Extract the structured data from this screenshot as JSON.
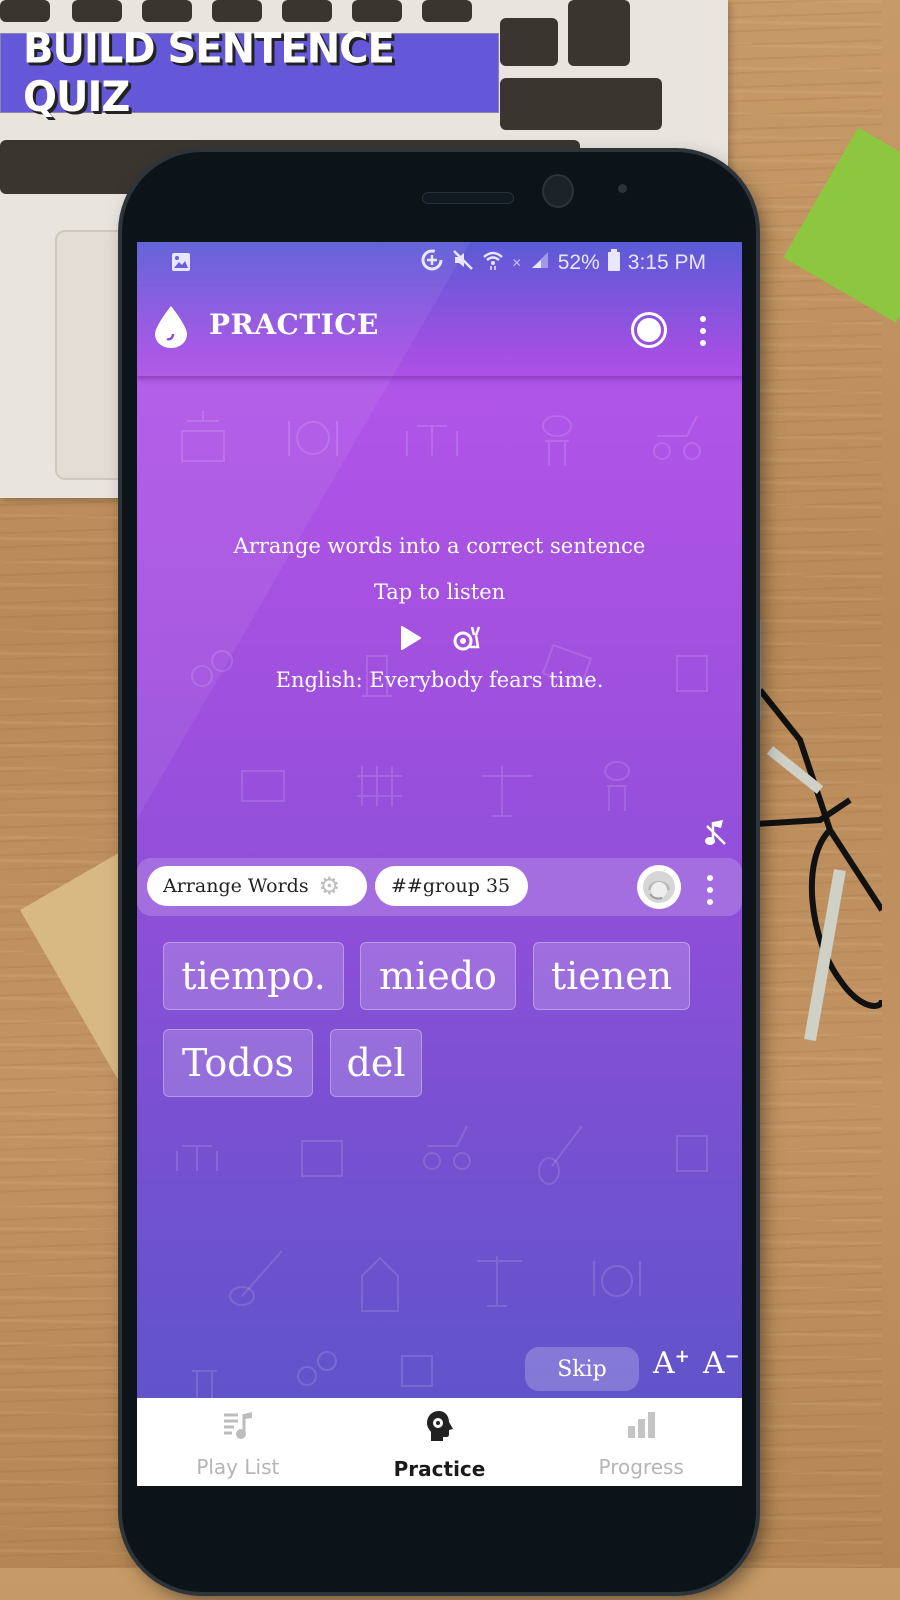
{
  "banner": {
    "title": "BUILD SENTENCE QUIZ"
  },
  "status_bar": {
    "battery": "52%",
    "time": "3:15 PM",
    "icons": [
      "gallery-icon",
      "data-saver-icon",
      "mute-icon",
      "wifi-icon",
      "nfc-icon",
      "signal-icon",
      "battery-icon"
    ]
  },
  "app_bar": {
    "title": "PRACTICE",
    "icons": [
      "drop-logo-icon",
      "timer-icon",
      "more-options-icon"
    ]
  },
  "prompt": {
    "instruction": "Arrange words into a correct sentence",
    "tap_to_listen": "Tap to listen",
    "translation": "English: Everybody fears time.",
    "controls": [
      "play-icon",
      "slow-play-snail-icon"
    ]
  },
  "tag_bar": {
    "mode_chip": "Arrange Words",
    "group_chip": "##group 35",
    "icons": [
      "mute-sound-icon",
      "settings-gear-icon",
      "support-agent-avatar-icon",
      "more-options-icon"
    ]
  },
  "word_tiles": [
    {
      "text": "tiempo."
    },
    {
      "text": "miedo"
    },
    {
      "text": "tienen"
    },
    {
      "text": "Todos"
    },
    {
      "text": "del"
    }
  ],
  "actions": {
    "skip": "Skip",
    "font_increase": "A",
    "font_increase_sign": "+",
    "font_decrease": "A",
    "font_decrease_sign": "−"
  },
  "bottom_nav": {
    "items": [
      {
        "label": "Play List",
        "icon": "playlist-music-icon",
        "active": false
      },
      {
        "label": "Practice",
        "icon": "head-gear-icon",
        "active": true
      },
      {
        "label": "Progress",
        "icon": "bar-chart-icon",
        "active": false
      }
    ]
  },
  "colors": {
    "banner_bg": "#6457d8",
    "gradient_top": "#5b5bd6",
    "gradient_mid": "#b055e8",
    "gradient_bottom": "#5955c8",
    "nav_active": "#1a1a1a",
    "nav_inactive": "#b5b5b5"
  }
}
